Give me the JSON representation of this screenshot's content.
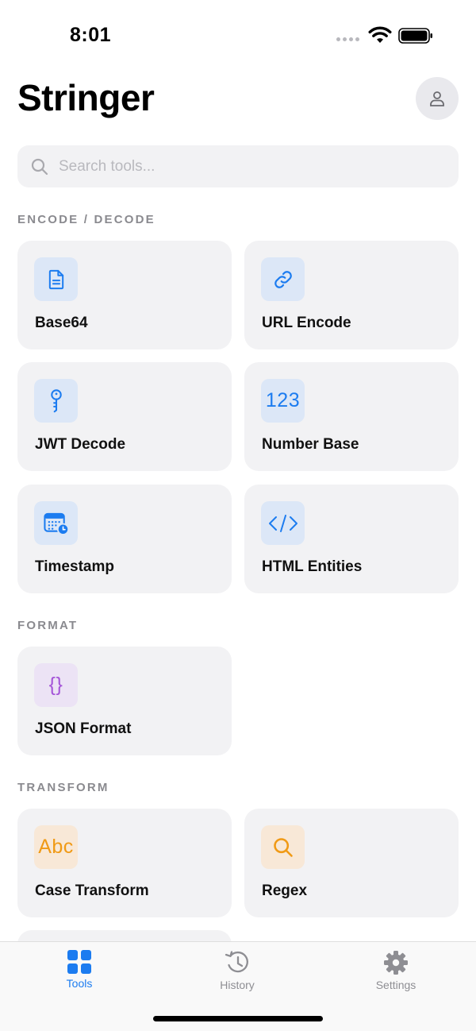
{
  "status_bar": {
    "time": "8:01"
  },
  "header": {
    "title": "Stringer"
  },
  "search": {
    "placeholder": "Search tools..."
  },
  "sections": [
    {
      "title": "ENCODE / DECODE",
      "tools": [
        {
          "label": "Base64",
          "icon": "document-icon",
          "color": "#1c7cf0"
        },
        {
          "label": "URL Encode",
          "icon": "link-icon",
          "color": "#1c7cf0"
        },
        {
          "label": "JWT Decode",
          "icon": "key-icon",
          "color": "#1c7cf0"
        },
        {
          "label": "Number Base",
          "icon_text": "123",
          "color": "#1c7cf0"
        },
        {
          "label": "Timestamp",
          "icon": "calendar-clock-icon",
          "color": "#1c7cf0"
        },
        {
          "label": "HTML Entities",
          "icon": "code-icon",
          "color": "#1c7cf0"
        }
      ]
    },
    {
      "title": "FORMAT",
      "tools": [
        {
          "label": "JSON Format",
          "icon_text": "{}",
          "color": "#a454d8"
        }
      ]
    },
    {
      "title": "TRANSFORM",
      "tools": [
        {
          "label": "Case Transform",
          "icon_text": "Abc",
          "color": "#f09a16"
        },
        {
          "label": "Regex",
          "icon": "magnifier-icon",
          "color": "#f09a16"
        }
      ]
    }
  ],
  "tab_bar": {
    "tabs": [
      {
        "label": "Tools",
        "icon": "grid-icon",
        "active": true
      },
      {
        "label": "History",
        "icon": "history-icon",
        "active": false
      },
      {
        "label": "Settings",
        "icon": "gear-icon",
        "active": false
      }
    ],
    "active_color": "#1c7cf0",
    "inactive_color": "#8e8e93"
  }
}
